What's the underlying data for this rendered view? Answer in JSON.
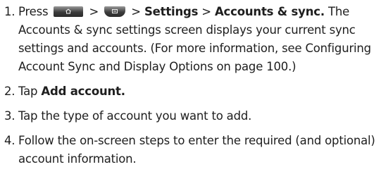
{
  "steps": [
    {
      "number": "1.",
      "press": "Press",
      "sep1": ">",
      "sep2": ">",
      "settings": "Settings",
      "sep3": ">",
      "accounts_sync": "Accounts & sync.",
      "description": "The Accounts & sync settings screen displays your current sync settings and accounts. (For more information, see Configuring Account Sync and Display Options on page 100.)"
    },
    {
      "number": "2.",
      "tap": "Tap",
      "bold": "Add account."
    },
    {
      "number": "3.",
      "text": "Tap the type of account you want to add."
    },
    {
      "number": "4.",
      "text": "Follow the on-screen steps to enter the required (and optional) account information."
    }
  ],
  "icons": {
    "home_key": "home-key-icon",
    "menu_key": "menu-key-icon"
  }
}
